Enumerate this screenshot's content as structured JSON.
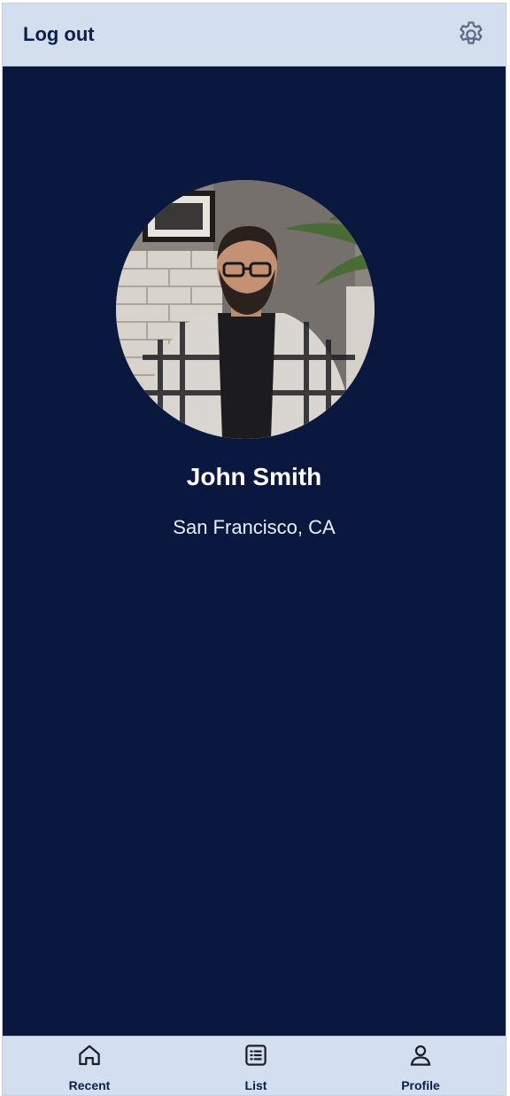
{
  "header": {
    "logout_label": "Log out",
    "settings_icon": "gear-icon"
  },
  "profile": {
    "name": "John Smith",
    "location": "San Francisco, CA",
    "avatar_icon": "profile-photo"
  },
  "bottom_nav": {
    "items": [
      {
        "label": "Recent",
        "icon": "home-icon"
      },
      {
        "label": "List",
        "icon": "list-icon"
      },
      {
        "label": "Profile",
        "icon": "user-icon"
      }
    ]
  },
  "colors": {
    "background": "#0a1840",
    "bar": "#d3dfee",
    "text_dark": "#0d1e4a"
  }
}
